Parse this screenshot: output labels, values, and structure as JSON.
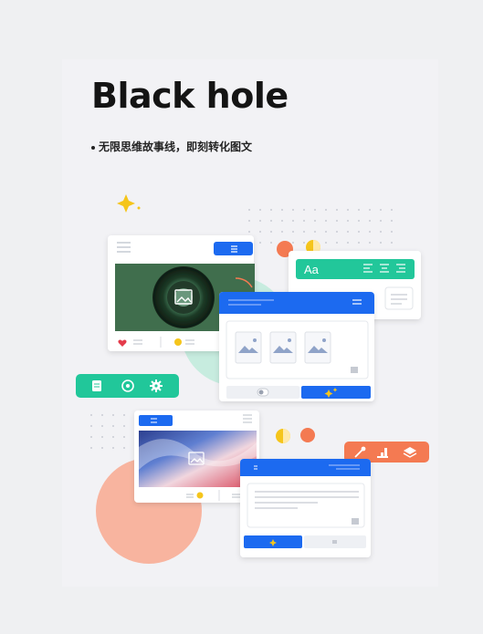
{
  "poster": {
    "title": "Black hole",
    "subtitle": "无限思维故事线，即刻转化图文"
  },
  "illustration": {
    "text_style_label": "Aa",
    "colors": {
      "primary_blue": "#1f6bf0",
      "mint_green": "#21c79a",
      "orange": "#f47a52",
      "salmon_circle": "#f8b49f",
      "yellow": "#f5c51b",
      "heart_red": "#e43a4c"
    },
    "icons": [
      "sparkle-icon",
      "menu-icon",
      "image-icon",
      "heart-icon",
      "document-icon",
      "target-icon",
      "gear-icon",
      "toggle-icon",
      "magic-wand-icon",
      "edit-icon",
      "chart-icon",
      "layers-icon",
      "align-left-icon",
      "align-center-icon",
      "align-right-icon"
    ]
  }
}
